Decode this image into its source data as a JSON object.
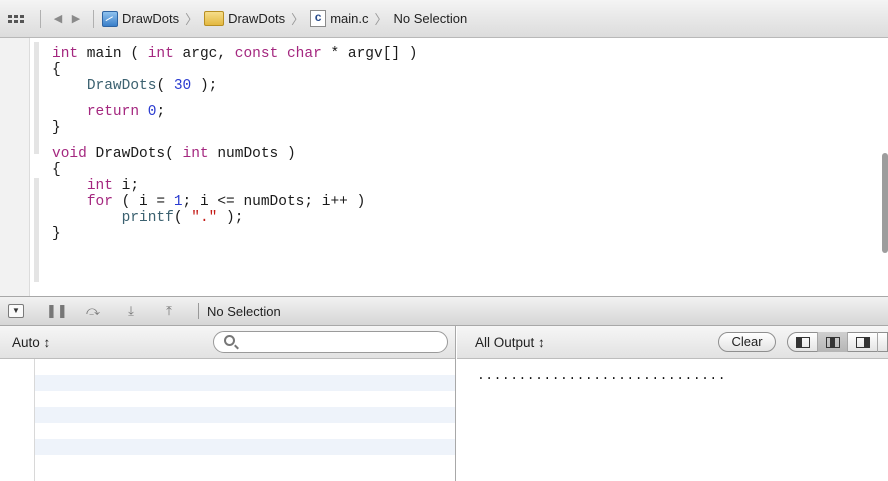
{
  "jumpbar": {
    "crumbs": [
      "DrawDots",
      "DrawDots",
      "main.c",
      "No Selection"
    ],
    "back_icon": "back-arrow-icon",
    "forward_icon": "forward-arrow-icon",
    "related_icon": "related-items-grid-icon",
    "file_icon_letter": "c"
  },
  "code": {
    "lines": [
      [
        [
          "kw",
          "int"
        ],
        [
          "t",
          " main ( "
        ],
        [
          "kw",
          "int"
        ],
        [
          "t",
          " argc, "
        ],
        [
          "kw",
          "const"
        ],
        [
          "t",
          " "
        ],
        [
          "kw",
          "char"
        ],
        [
          "t",
          " * argv[] )"
        ]
      ],
      [
        [
          "t",
          "{"
        ]
      ],
      [
        [
          "t",
          "    "
        ],
        [
          "fn",
          "DrawDots"
        ],
        [
          "t",
          "( "
        ],
        [
          "num",
          "30"
        ],
        [
          "t",
          " );"
        ]
      ],
      "gap",
      [
        [
          "t",
          "    "
        ],
        [
          "kw",
          "return"
        ],
        [
          "t",
          " "
        ],
        [
          "num",
          "0"
        ],
        [
          "t",
          ";"
        ]
      ],
      [
        [
          "t",
          "}"
        ]
      ],
      "gap",
      [
        [
          "kw",
          "void"
        ],
        [
          "t",
          " DrawDots( "
        ],
        [
          "kw",
          "int"
        ],
        [
          "t",
          " numDots )"
        ]
      ],
      [
        [
          "t",
          "{"
        ]
      ],
      [
        [
          "t",
          "    "
        ],
        [
          "kw",
          "int"
        ],
        [
          "t",
          " i;"
        ]
      ],
      [
        [
          "t",
          "    "
        ],
        [
          "kw",
          "for"
        ],
        [
          "t",
          " ( i = "
        ],
        [
          "num",
          "1"
        ],
        [
          "t",
          "; i <= numDots; i++ )"
        ]
      ],
      [
        [
          "t",
          "        "
        ],
        [
          "fn",
          "printf"
        ],
        [
          "t",
          "( "
        ],
        [
          "str",
          "\".\""
        ],
        [
          "t",
          " );"
        ]
      ],
      [
        [
          "t",
          "}"
        ]
      ]
    ]
  },
  "debugbar": {
    "toggle_icon": "hide-debug-area-icon",
    "icons": [
      "pause-icon",
      "step-over-icon",
      "step-into-icon",
      "step-out-icon"
    ],
    "selection_label": "No Selection"
  },
  "variables": {
    "scope_label": "Auto ↕",
    "search_placeholder": "",
    "row_count": 7
  },
  "console": {
    "filter_label": "All Output ↕",
    "clear_label": "Clear",
    "output": ".............................."
  },
  "colors": {
    "keyword": "#a4277f",
    "number": "#2a3bd0",
    "function": "#3b6170",
    "string": "#c41a16"
  }
}
